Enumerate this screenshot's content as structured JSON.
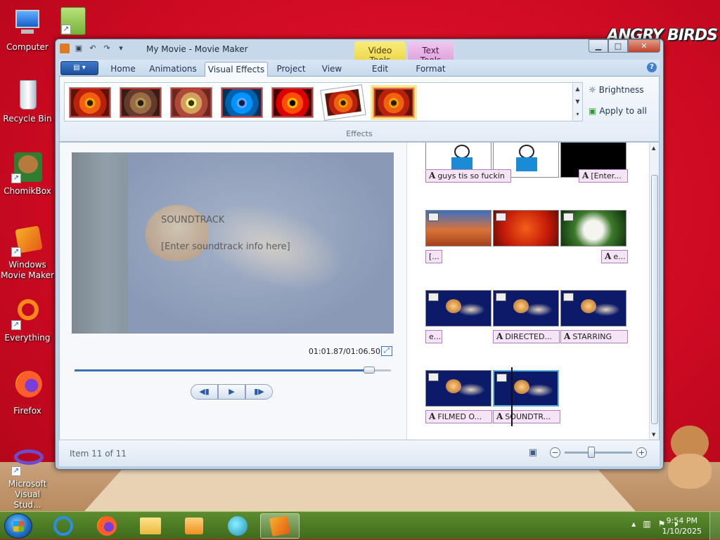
{
  "desktop": {
    "icons": [
      {
        "label": "Computer"
      },
      {
        "label": "Recycle Bin"
      },
      {
        "label": "ChomikBox"
      },
      {
        "label": "Windows Movie Maker"
      },
      {
        "label": "Everything"
      },
      {
        "label": "Firefox"
      },
      {
        "label": "Microsoft Visual Stud..."
      }
    ],
    "wallpaper_logo": "ANGRY BIRDS"
  },
  "window": {
    "title": "My Movie - Movie Maker",
    "context_tabs": {
      "video": "Video Tools",
      "text": "Text Tools"
    },
    "tabs": [
      "Home",
      "Animations",
      "Visual Effects",
      "Project",
      "View",
      "Edit",
      "Format"
    ],
    "active_tab": "Visual Effects",
    "ribbon": {
      "group_label": "Effects",
      "brightness_label": "Brightness",
      "apply_all_label": "Apply to all"
    },
    "preview": {
      "title_text": "SOUNDTRACK",
      "body_text": "[Enter soundtrack info here]",
      "time": "01:01.87/01:06.50",
      "progress": 0.93
    },
    "storyboard": {
      "captions": [
        "guys tis so fuckin",
        "[Enter...",
        "[...",
        "e...",
        "e...",
        "DIRECTED...",
        "STARRING",
        "FILMED O...",
        "SOUNDTR..."
      ]
    },
    "status": {
      "item_text": "Item 11 of 11",
      "zoom_level": 0.4
    }
  },
  "taskbar": {
    "clock_time": "9:54 PM",
    "clock_date": "1/10/2025"
  },
  "colors": {
    "accent": "#3d6fb5",
    "video_tools": "#f0dc55",
    "text_tools": "#e3aee0",
    "taskbar": "#4e7d25"
  }
}
